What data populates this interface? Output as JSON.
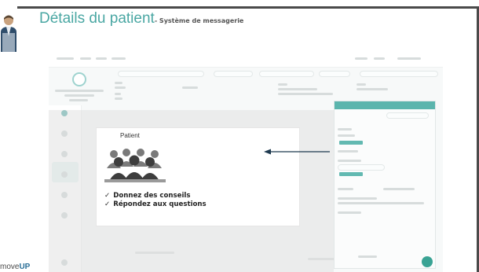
{
  "slide": {
    "title_main": "Détails du patient",
    "title_sub": "- Système de messagerie",
    "logo_prefix": "move",
    "logo_suffix": "UP"
  },
  "callout": {
    "title": "Patient",
    "bullets": [
      {
        "check": "✓",
        "text": "Donnez des conseils"
      },
      {
        "check": "✓",
        "text": "Répondez aux questions"
      }
    ]
  },
  "colors": {
    "accent": "#4aa7a3",
    "arrow": "#1e3a4f",
    "overlay": "#e1e1e1"
  }
}
